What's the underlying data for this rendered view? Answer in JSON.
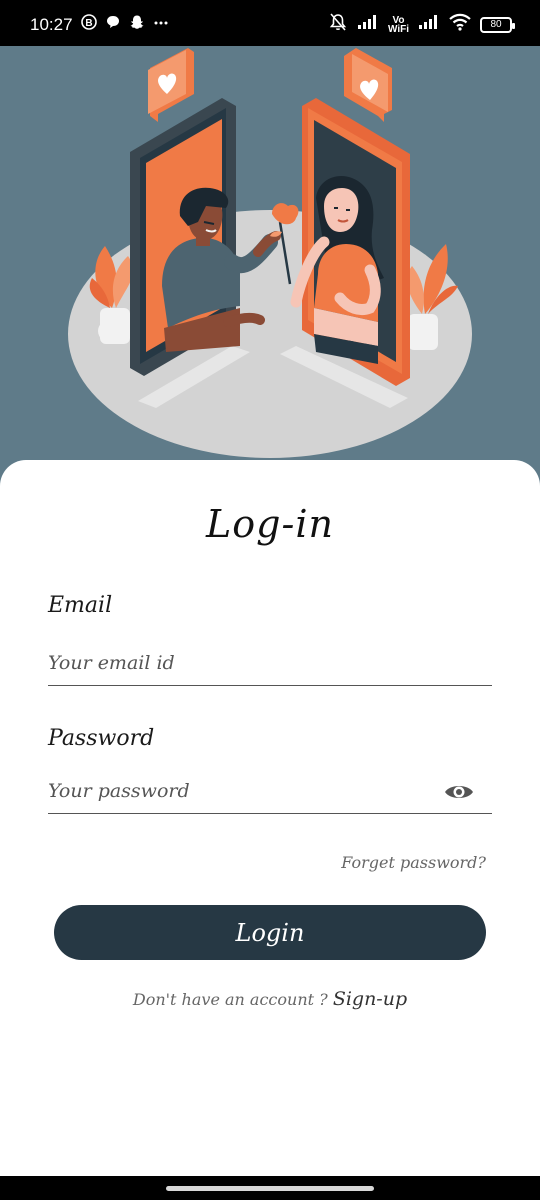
{
  "status_bar": {
    "time": "10:27",
    "left_icons": [
      "b-circle-icon",
      "chat-bubble-icon",
      "snapchat-icon",
      "more-dots-icon"
    ],
    "vowifi_top": "Vo",
    "vowifi_bottom": "WiFi",
    "battery": "80"
  },
  "hero": {
    "image": "dating-app-illustration",
    "colors": {
      "background": "#5f7b89",
      "accent": "#f07a46"
    }
  },
  "login": {
    "title": "Log-in",
    "email_label": "Email",
    "email_placeholder": "Your email id",
    "password_label": "Password",
    "password_placeholder": "Your password",
    "forgot_label": "Forget password?",
    "login_button": "Login",
    "no_account_text": "Don't have an account ? ",
    "signup_link": "Sign-up"
  },
  "colors": {
    "button": "#263844",
    "card": "#ffffff"
  }
}
